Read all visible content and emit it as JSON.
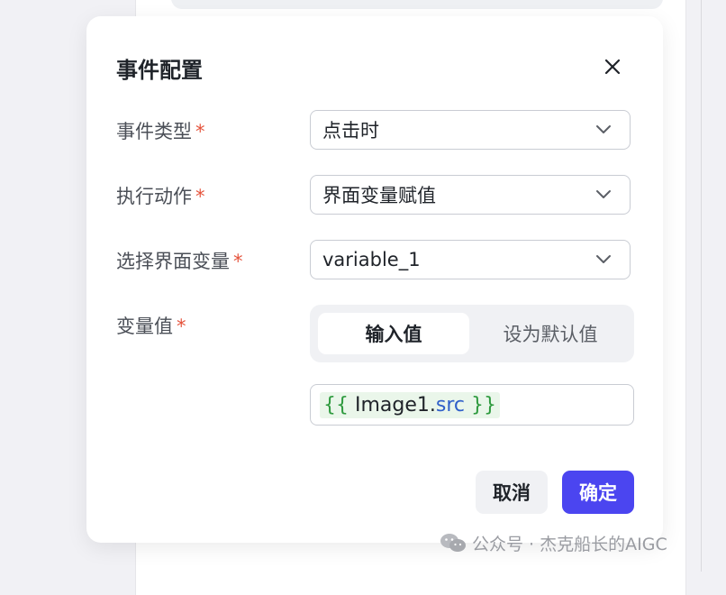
{
  "dialog": {
    "title": "事件配置",
    "close_icon": "close-icon"
  },
  "fields": {
    "event_type": {
      "label": "事件类型",
      "required_mark": "*",
      "value": "点击时"
    },
    "action": {
      "label": "执行动作",
      "required_mark": "*",
      "value": "界面变量赋值"
    },
    "variable": {
      "label": "选择界面变量",
      "required_mark": "*",
      "value": "variable_1"
    },
    "variable_value": {
      "label": "变量值",
      "required_mark": "*",
      "tabs": [
        {
          "label": "输入值",
          "active": true
        },
        {
          "label": "设为默认值",
          "active": false
        }
      ],
      "expression": {
        "open": "{{",
        "object": " Image1.",
        "property": "src",
        "close": " }}"
      }
    }
  },
  "footer": {
    "cancel_label": "取消",
    "confirm_label": "确定"
  },
  "watermark": {
    "text": "公众号 · 杰克船长的AIGC"
  },
  "colors": {
    "primary": "#4b45f0",
    "required": "#e5533c",
    "expression_brace": "#2e9a3e",
    "expression_property": "#2f5fc9",
    "expression_background": "#eaf6ea"
  }
}
